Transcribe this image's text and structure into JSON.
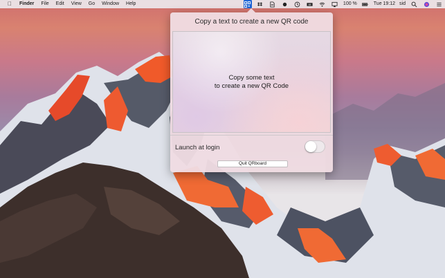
{
  "menubar": {
    "apple_icon": "apple-logo",
    "menus": [
      "Finder",
      "File",
      "Edit",
      "View",
      "Go",
      "Window",
      "Help"
    ],
    "status_icons": [
      "qr-icon",
      "dropbox-icon",
      "document-icon",
      "record-dot-icon",
      "time-machine-icon",
      "battery-monitor-icon",
      "wifi-icon",
      "airplay-icon"
    ],
    "battery_percent": "100 %",
    "clock": "Tue 19:12",
    "user": "sid",
    "trailing_icons": [
      "search-icon",
      "siri-icon",
      "list-icon"
    ]
  },
  "popover": {
    "title": "Copy a text to create a new QR code",
    "hint_line1": "Copy some text",
    "hint_line2": "to create a new QR Code",
    "launch_label": "Launch at login",
    "launch_enabled": false,
    "quit_label": "Quit QRboard"
  },
  "colors": {
    "accent": "#1f66d6",
    "popover_bg": "#efdce2"
  }
}
